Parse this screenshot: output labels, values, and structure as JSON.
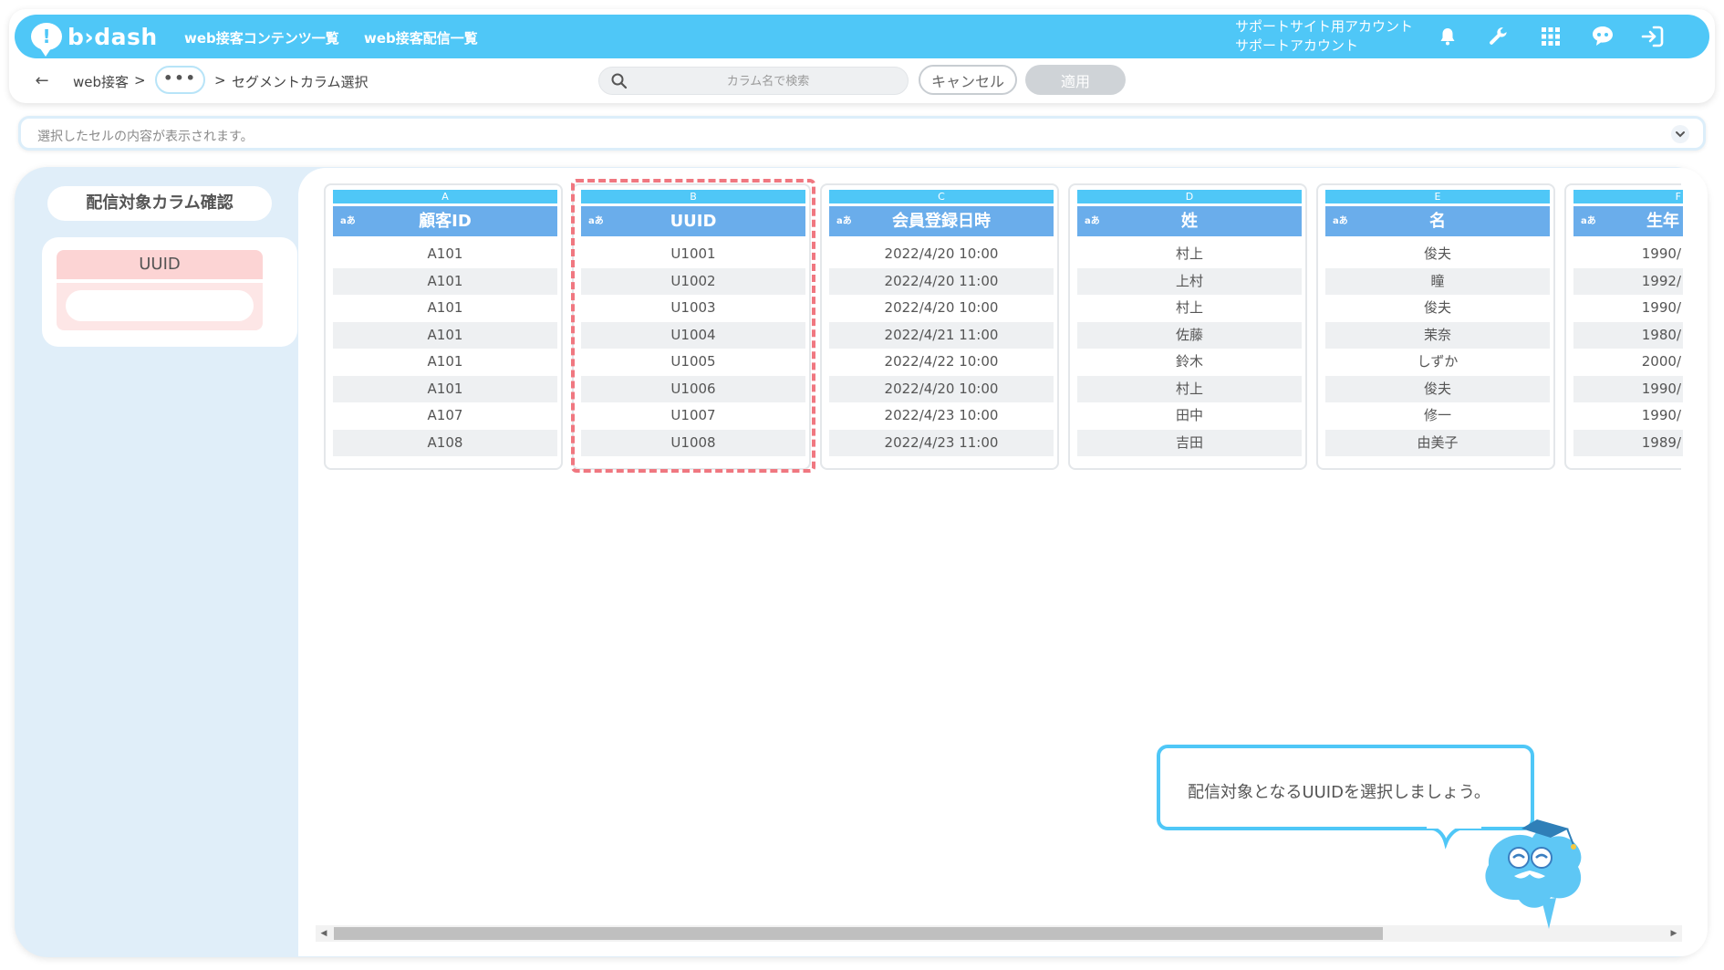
{
  "header": {
    "logo_text": "b›dash",
    "logo_mark": "!",
    "nav": [
      "web接客コンテンツ一覧",
      "web接客配信一覧"
    ],
    "account_line1": "サポートサイト用アカウント",
    "account_line2": "サポートアカウント",
    "icons": [
      "bell-icon",
      "wrench-icon",
      "grid-icon",
      "chat-brain-icon",
      "logout-icon"
    ],
    "brand_color": "#4fc7f7"
  },
  "breadcrumb": {
    "back": "←",
    "first": "web接客",
    "sep": ">",
    "more": "•••",
    "current": "セグメントカラム選択"
  },
  "search": {
    "placeholder": "カラム名で検索"
  },
  "actions": {
    "cancel_label": "キャンセル",
    "apply_label": "適用"
  },
  "cell_bar": {
    "placeholder": "選択したセルの内容が表示されます。"
  },
  "side": {
    "title": "配信対象カラム確認",
    "selected_label": "UUID"
  },
  "columns": [
    {
      "letter": "A",
      "type": "aあ",
      "header": "顧客ID",
      "cells": [
        "A101",
        "A101",
        "A101",
        "A101",
        "A101",
        "A101",
        "A107",
        "A108"
      ]
    },
    {
      "letter": "B",
      "type": "aあ",
      "header": "UUID",
      "cells": [
        "U1001",
        "U1002",
        "U1003",
        "U1004",
        "U1005",
        "U1006",
        "U1007",
        "U1008"
      ]
    },
    {
      "letter": "C",
      "type": "aあ",
      "header": "会員登録日時",
      "cells": [
        "2022/4/20 10:00",
        "2022/4/20 11:00",
        "2022/4/20 10:00",
        "2022/4/21 11:00",
        "2022/4/22 10:00",
        "2022/4/20 10:00",
        "2022/4/23 10:00",
        "2022/4/23 11:00"
      ]
    },
    {
      "letter": "D",
      "type": "aあ",
      "header": "姓",
      "cells": [
        "村上",
        "上村",
        "村上",
        "佐藤",
        "鈴木",
        "村上",
        "田中",
        "吉田"
      ]
    },
    {
      "letter": "E",
      "type": "aあ",
      "header": "名",
      "cells": [
        "俊夫",
        "瞳",
        "俊夫",
        "茉奈",
        "しずか",
        "俊夫",
        "修一",
        "由美子"
      ]
    },
    {
      "letter": "F",
      "type": "aあ",
      "header": "生年",
      "cells": [
        "1990/",
        "1992/",
        "1990/",
        "1980/",
        "2000/",
        "1990/",
        "1990/",
        "1989/"
      ]
    }
  ],
  "highlight_color": "#f07780",
  "hint": {
    "text": "配信対象となるUUIDを選択しましょう。"
  },
  "scroll": {
    "left": "◀",
    "right": "▶"
  }
}
